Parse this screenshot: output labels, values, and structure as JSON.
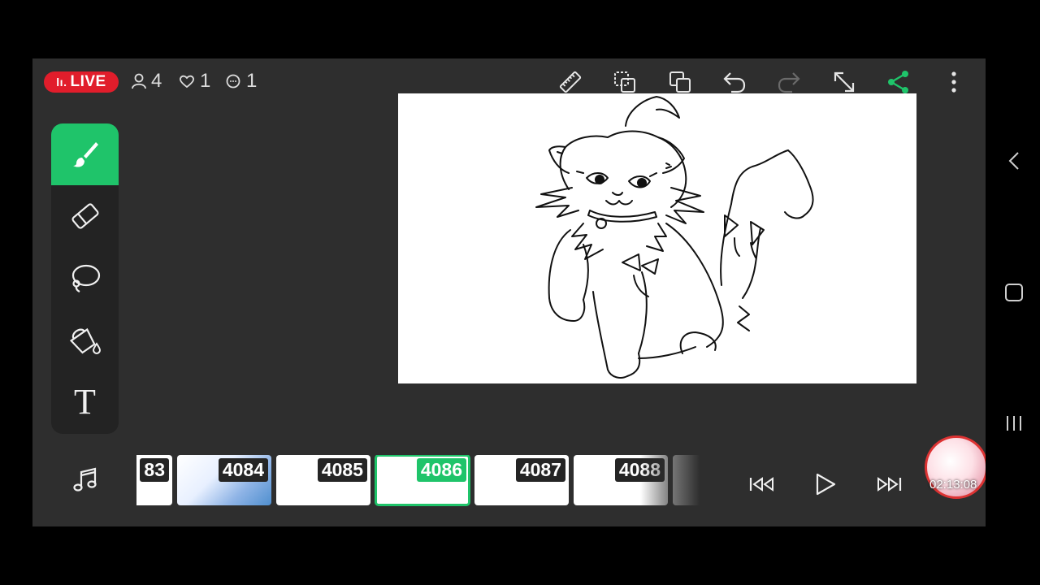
{
  "live": {
    "label": "LIVE",
    "bars": "lı."
  },
  "stats": {
    "viewers": "4",
    "likes": "1",
    "comments": "1"
  },
  "toolbar": {
    "icons": [
      "ruler-icon",
      "copy-layer-icon",
      "duplicate-icon",
      "undo-icon",
      "redo-icon",
      "expand-icon",
      "share-icon",
      "more-icon"
    ],
    "accent": "#1fc46a"
  },
  "tools": {
    "text_label": "T"
  },
  "frames": [
    {
      "num": "83"
    },
    {
      "num": "4084"
    },
    {
      "num": "4085"
    },
    {
      "num": "4086"
    },
    {
      "num": "4087"
    },
    {
      "num": "4088"
    }
  ],
  "playback": {
    "timer": "02:13:08"
  }
}
